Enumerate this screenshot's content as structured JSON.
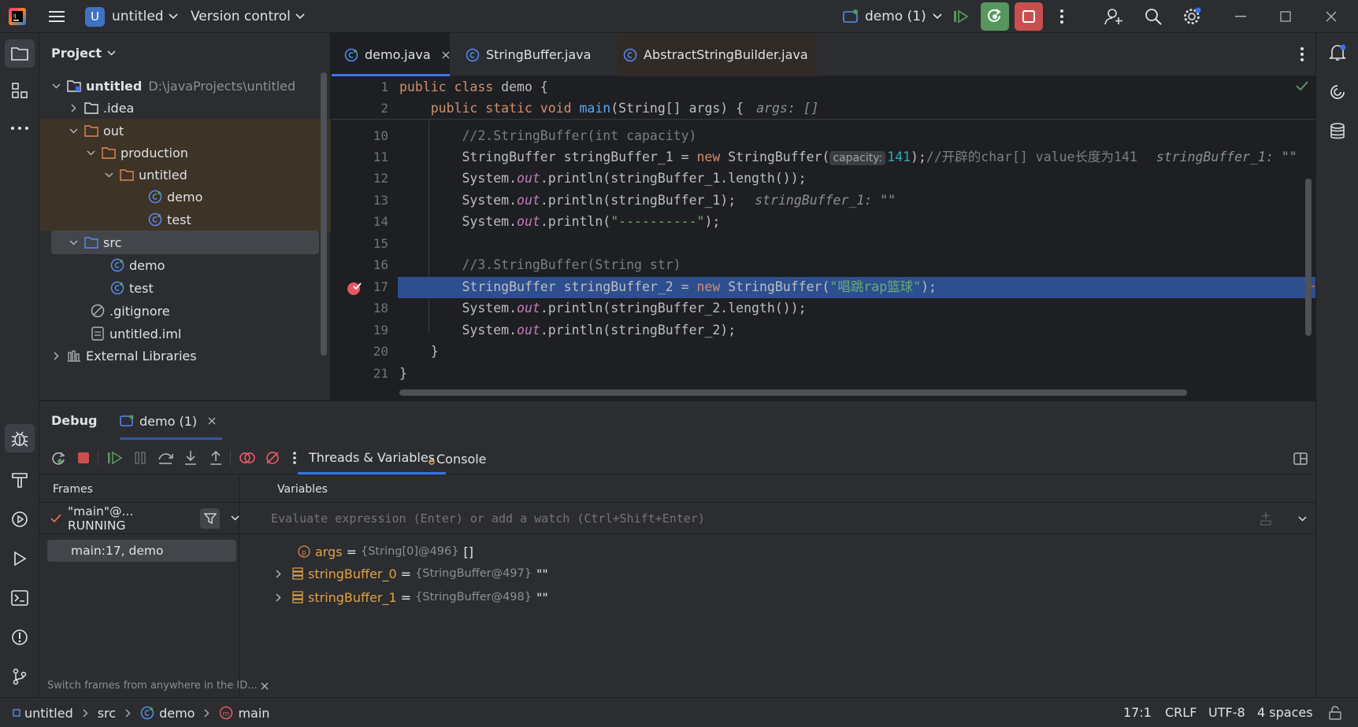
{
  "titlebar": {
    "project_initial": "U",
    "project_name": "untitled",
    "vcs": "Version control",
    "run_config": "demo (1)"
  },
  "project_panel": {
    "title": "Project",
    "tree": [
      {
        "label": "untitled",
        "path": "D:\\javaProjects\\untitled"
      },
      {
        "label": ".idea"
      },
      {
        "label": "out"
      },
      {
        "label": "production"
      },
      {
        "label": "untitled"
      },
      {
        "label": "demo"
      },
      {
        "label": "test"
      },
      {
        "label": "src"
      },
      {
        "label": "demo"
      },
      {
        "label": "test"
      },
      {
        "label": ".gitignore"
      },
      {
        "label": "untitled.iml"
      },
      {
        "label": "External Libraries"
      }
    ]
  },
  "editor": {
    "tabs": [
      "demo.java",
      "StringBuffer.java",
      "AbstractStringBuilder.java"
    ],
    "line_numbers": [
      "1",
      "2",
      "10",
      "11",
      "12",
      "13",
      "14",
      "15",
      "16",
      "17",
      "18",
      "19",
      "20",
      "21"
    ],
    "lines": {
      "l1a": "public class ",
      "l1b": "demo {",
      "l2a": "    public static void ",
      "l2b": "main",
      "l2c": "(String[] args) {",
      "l2hint": "args: []",
      "l10": "        //2.StringBuffer(int capacity)",
      "l11a": "        StringBuffer stringBuffer_1 = ",
      "l11b": "new",
      "l11c": " StringBuffer(",
      "l11param": "capacity:",
      "l11num": "141",
      "l11d": ");",
      "l11cmt": "//开辟的char[] value长度为141",
      "l11hint": "stringBuffer_1: \"\"",
      "l12a": "        System.",
      "l12out": "out",
      "l12b": ".println(stringBuffer_1.length());",
      "l13a": "        System.",
      "l13out": "out",
      "l13b": ".println(stringBuffer_1);",
      "l13hint": "stringBuffer_1: \"\"",
      "l14a": "        System.",
      "l14out": "out",
      "l14b": ".println(",
      "l14str": "\"----------\"",
      "l14c": ");",
      "l16": "        //3.StringBuffer(String str)",
      "l17a": "        StringBuffer stringBuffer_2 = ",
      "l17b": "new",
      "l17c": " StringBuffer(",
      "l17str": "\"唱跳rap篮球\"",
      "l17d": ");",
      "l18a": "        System.",
      "l18out": "out",
      "l18b": ".println(stringBuffer_2.length());",
      "l19a": "        System.",
      "l19out": "out",
      "l19b": ".println(stringBuffer_2);",
      "l20": "    }",
      "l21": "}"
    }
  },
  "debug": {
    "title": "Debug",
    "session_tab": "demo (1)",
    "tabs": [
      "Threads & Variables",
      "Console"
    ],
    "frames_header": "Frames",
    "variables_header": "Variables",
    "thread": "\"main\"@... RUNNING",
    "frame": "main:17, demo",
    "eval_placeholder": "Evaluate expression (Enter) or add a watch (Ctrl+Shift+Enter)",
    "variables": [
      {
        "name": "args",
        "type": "{String[0]@496}",
        "value": "[]"
      },
      {
        "name": "stringBuffer_0",
        "type": "{StringBuffer@497}",
        "value": "\"\""
      },
      {
        "name": "stringBuffer_1",
        "type": "{StringBuffer@498}",
        "value": "\"\""
      }
    ],
    "equals": "=",
    "hint": "Switch frames from anywhere in the ID..."
  },
  "statusbar": {
    "breadcrumbs": [
      "untitled",
      "src",
      "demo",
      "main"
    ],
    "position": "17:1",
    "line_sep": "CRLF",
    "encoding": "UTF-8",
    "indent": "4 spaces"
  },
  "colors": {
    "accent": "#3574f0",
    "exec_line": "#2d4f8f",
    "run_green": "#57965c",
    "stop_red": "#c94f4f",
    "dir_highlight": "#3d3326"
  }
}
